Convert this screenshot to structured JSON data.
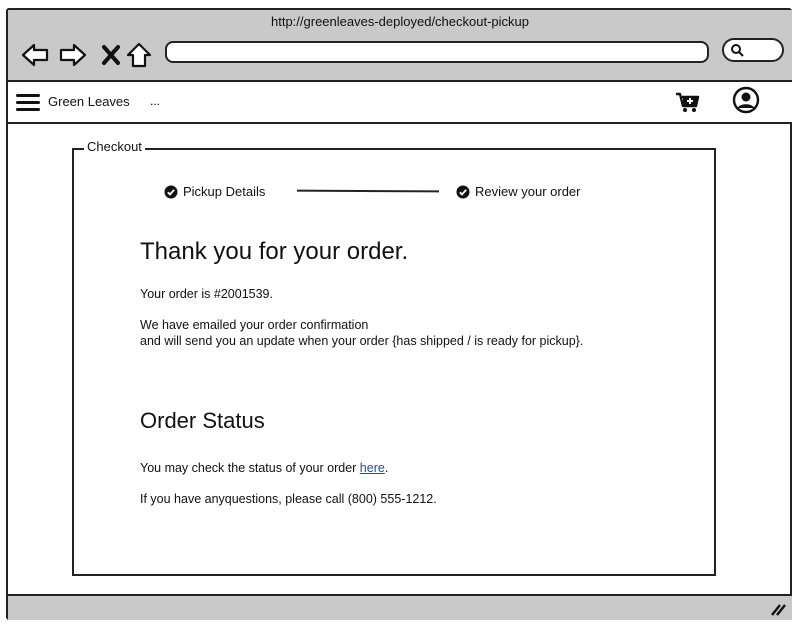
{
  "browser": {
    "url": "http://greenleaves-deployed/checkout-pickup",
    "icons": [
      "back-icon",
      "forward-icon",
      "close-icon",
      "home-icon",
      "search-icon"
    ]
  },
  "navbar": {
    "brand": "Green Leaves",
    "ellipsis": "...",
    "icons": [
      "hamburger-menu-icon",
      "cart-icon",
      "user-icon"
    ]
  },
  "checkout": {
    "legend": "Checkout",
    "steps": [
      {
        "label": "Pickup Details",
        "icon": "check-circle-icon"
      },
      {
        "label": "Review your order",
        "icon": "check-circle-icon"
      }
    ],
    "thank_you_title": "Thank you for your order.",
    "order_number_text": "Your order is #2001539.",
    "confirmation_line1": "We have emailed your order confirmation",
    "confirmation_line2": "and will send you an update when your order {has shipped / is ready for pickup}.",
    "status_title": "Order Status",
    "status_text_prefix": "You may check the status of your order ",
    "status_link": "here",
    "status_text_suffix": ".",
    "questions_text": "If you have anyquestions, please call (800) 555-1212."
  },
  "colors": {
    "chrome": "#c9c9c9",
    "link": "#1f4ea1",
    "border": "#222222"
  }
}
